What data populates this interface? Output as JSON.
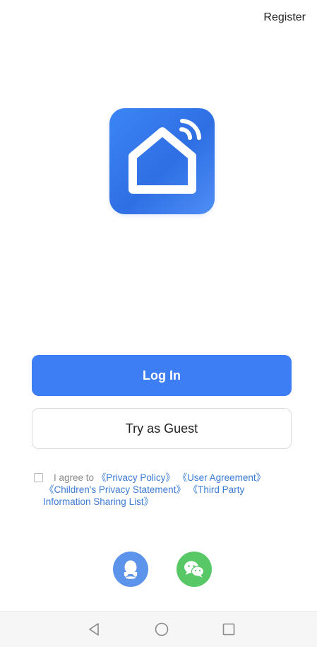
{
  "header": {
    "register_label": "Register"
  },
  "logo": {
    "icon": "smart-home-wifi-icon",
    "gradient_start": "#3c85f5",
    "gradient_end": "#2f6fe4"
  },
  "actions": {
    "login_label": "Log In",
    "guest_label": "Try as Guest",
    "login_color": "#3d7ef5"
  },
  "agreement": {
    "checked": false,
    "prefix": "I agree to",
    "privacy_policy": "《Privacy Policy》",
    "user_agreement": "《User Agreement》",
    "children_privacy": "《Children's Privacy Statement》",
    "third_party_1": "《Third Party",
    "third_party_2": "Information Sharing List》",
    "link_color": "#3b7bd8"
  },
  "social": {
    "qq_icon": "qq-penguin-icon",
    "qq_color": "#5b94ea",
    "wechat_icon": "wechat-icon",
    "wechat_color": "#58c866"
  },
  "system_nav": {
    "back_icon": "back-triangle-icon",
    "home_icon": "home-circle-icon",
    "recent_icon": "recent-apps-square-icon"
  }
}
